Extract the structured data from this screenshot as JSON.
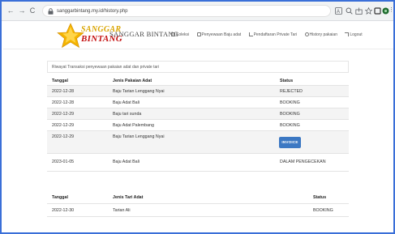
{
  "browser": {
    "url": "sanggarbintang.my.id/history.php",
    "back_icon": "arrow-left-icon",
    "forward_icon": "arrow-right-icon",
    "reload_icon": "reload-icon"
  },
  "header": {
    "logo_top": "SANGGAR",
    "logo_bottom": "BINTANG",
    "site_title": "SANGGAR BINTANG",
    "menu": [
      {
        "label": "Koleksi",
        "icon": "grid-icon"
      },
      {
        "label": "Penyewaan Baju adat",
        "icon": "cart-icon"
      },
      {
        "label": "Pendaftaran Private Tari",
        "icon": "dancer-icon"
      },
      {
        "label": "History pakaian",
        "icon": "history-icon"
      },
      {
        "label": "Logout",
        "icon": "logout-icon"
      }
    ]
  },
  "pakaian_section": {
    "caption": "Riwayat Transaksi penyewaan pakaian adat dan private tari",
    "headers": [
      "Tanggal",
      "Jenis Pakaian Adat",
      "Status"
    ],
    "rows": [
      {
        "date": "2022-12-28",
        "item": "Baju Tarian Lenggang Nyai",
        "status": "REJECTED"
      },
      {
        "date": "2022-12-28",
        "item": "Baju Adat Bali",
        "status": "BOOKING"
      },
      {
        "date": "2022-12-29",
        "item": "Baju tari sunda",
        "status": "BOOKING"
      },
      {
        "date": "2022-12-29",
        "item": "Baju Adat Palembang",
        "status": "BOOKING"
      },
      {
        "date": "2022-12-29",
        "item": "Baju Tarian Lenggang Nyai",
        "status": "INVOICE"
      },
      {
        "date": "2023-01-05",
        "item": "Baju Adat Bali",
        "status": "DALAM PENGECEKAN"
      }
    ]
  },
  "tari_section": {
    "headers": [
      "Tanggal",
      "Jenis Tari Adat",
      "Status"
    ],
    "rows": [
      {
        "date": "2022-12-30",
        "item": "Tarian Ali",
        "status": "BOOKING"
      }
    ]
  },
  "colors": {
    "invoice_button": "#3c78c3",
    "logo_yellow": "#d9a400",
    "logo_red": "#c41010",
    "frame_border": "#3a6fd8"
  }
}
